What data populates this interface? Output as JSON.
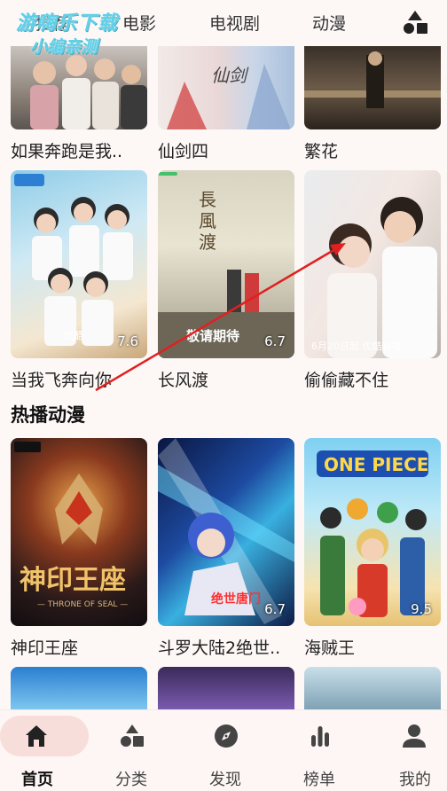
{
  "watermark": {
    "line1": "游嗨乐下载",
    "line2": "小编亲测"
  },
  "top_tabs": [
    "推荐",
    "电影",
    "电视剧",
    "动漫"
  ],
  "row1": [
    {
      "title": "如果奔跑是我.."
    },
    {
      "title": "仙剑四"
    },
    {
      "title": "繁花"
    }
  ],
  "row2": [
    {
      "title": "当我飞奔向你",
      "rating": "7.6",
      "poster_text": "优酷"
    },
    {
      "title": "长风渡",
      "rating": "6.7",
      "poster_text": "敬请期待"
    },
    {
      "title": "偷偷藏不住",
      "rating": "",
      "poster_text": "6月20日起 优酷独播"
    }
  ],
  "section": {
    "title": "热播动漫"
  },
  "anime": [
    {
      "title": "神印王座",
      "rating": "",
      "poster_text": "神印王座",
      "poster_sub": "— THRONE OF SEAL —"
    },
    {
      "title": "斗罗大陆2绝世..",
      "rating": "6.7",
      "poster_text": "绝世唐门"
    },
    {
      "title": "海贼王",
      "rating": "9.5",
      "poster_text": "ONE PIECE"
    }
  ],
  "bottom_nav": [
    {
      "label": "首页",
      "icon": "home-icon"
    },
    {
      "label": "分类",
      "icon": "category-icon"
    },
    {
      "label": "发现",
      "icon": "compass-icon"
    },
    {
      "label": "榜单",
      "icon": "chart-icon"
    },
    {
      "label": "我的",
      "icon": "user-icon"
    }
  ],
  "colors": {
    "accent": "#f7dedb",
    "arrow": "#e02020",
    "background": "#fdf8f6"
  }
}
